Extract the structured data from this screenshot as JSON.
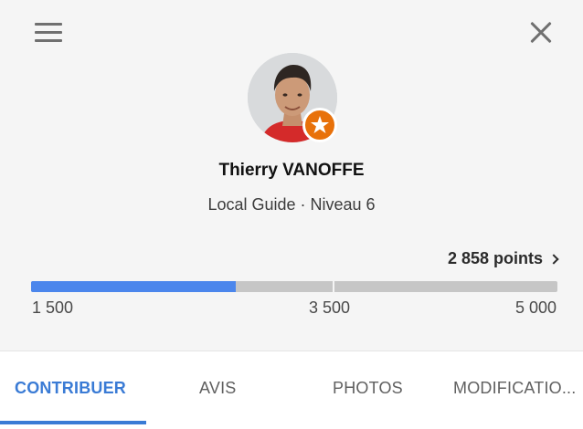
{
  "header": {
    "menu_icon": "hamburger-menu-icon",
    "close_icon": "close-icon"
  },
  "profile": {
    "name": "Thierry VANOFFE",
    "subtitle": "Local Guide · Niveau 6",
    "badge_icon": "local-guide-star-icon",
    "badge_color": "#e8710a"
  },
  "progress": {
    "points_label": "2 858 points",
    "current_points": 2858,
    "min": 1500,
    "mid": 3500,
    "max": 5000,
    "min_label": "1 500",
    "mid_label": "3 500",
    "max_label": "5 000",
    "fill_color": "#4b86ec"
  },
  "tabs": [
    {
      "label": "CONTRIBUER",
      "active": true
    },
    {
      "label": "AVIS",
      "active": false
    },
    {
      "label": "PHOTOS",
      "active": false
    },
    {
      "label": "MODIFICATIO...",
      "active": false
    }
  ],
  "accent_color": "#3a7bd5"
}
